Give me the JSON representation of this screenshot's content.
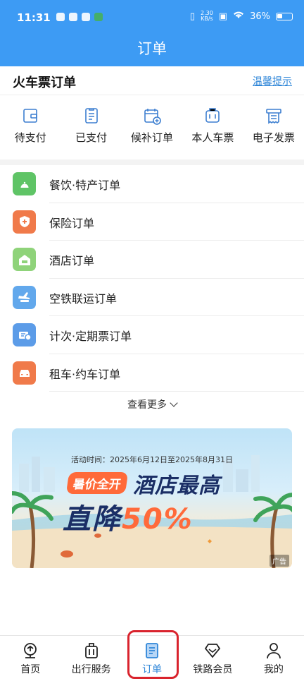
{
  "status_bar": {
    "time": "11:31",
    "speed_top": "2.30",
    "speed_unit": "KB/s",
    "battery": "36%"
  },
  "header": {
    "title": "订单"
  },
  "train_section": {
    "title": "火车票订单",
    "tips_link": "温馨提示"
  },
  "quick_actions": [
    {
      "label": "待支付",
      "icon": "wallet-icon"
    },
    {
      "label": "已支付",
      "icon": "receipt-icon"
    },
    {
      "label": "候补订单",
      "icon": "calendar-add-icon"
    },
    {
      "label": "本人车票",
      "icon": "ticket-icon"
    },
    {
      "label": "电子发票",
      "icon": "invoice-icon"
    }
  ],
  "order_list": [
    {
      "label": "餐饮·特产订单",
      "icon": "food-bell-icon",
      "color": "#5fc466"
    },
    {
      "label": "保险订单",
      "icon": "shield-plus-icon",
      "color": "#f07a4a"
    },
    {
      "label": "酒店订单",
      "icon": "hotel-icon",
      "color": "#8fd37a"
    },
    {
      "label": "空铁联运订单",
      "icon": "plane-train-icon",
      "color": "#62a8ec"
    },
    {
      "label": "计次·定期票订单",
      "icon": "pass-card-icon",
      "color": "#5c9ce8"
    },
    {
      "label": "租车·约车订单",
      "icon": "car-icon",
      "color": "#f07a4a"
    }
  ],
  "more": {
    "label": "查看更多"
  },
  "banner": {
    "date_text": "活动时间：2025年6月12日至2025年8月31日",
    "tag": "暑价全开",
    "headline_1": "酒店最高",
    "headline_2a": "直降",
    "headline_2b": "50%",
    "ad_label": "广告"
  },
  "tabbar": {
    "active": "订单",
    "items": [
      {
        "label": "首页",
        "icon": "home-train-icon"
      },
      {
        "label": "出行服务",
        "icon": "luggage-icon"
      },
      {
        "label": "订单",
        "icon": "order-document-icon"
      },
      {
        "label": "铁路会员",
        "icon": "diamond-icon"
      },
      {
        "label": "我的",
        "icon": "user-icon"
      }
    ]
  },
  "colors": {
    "brand_blue": "#3d9bf4",
    "link_blue": "#2f86d8",
    "highlight_red": "#d9232d",
    "accent_orange": "#ff6a3a"
  }
}
